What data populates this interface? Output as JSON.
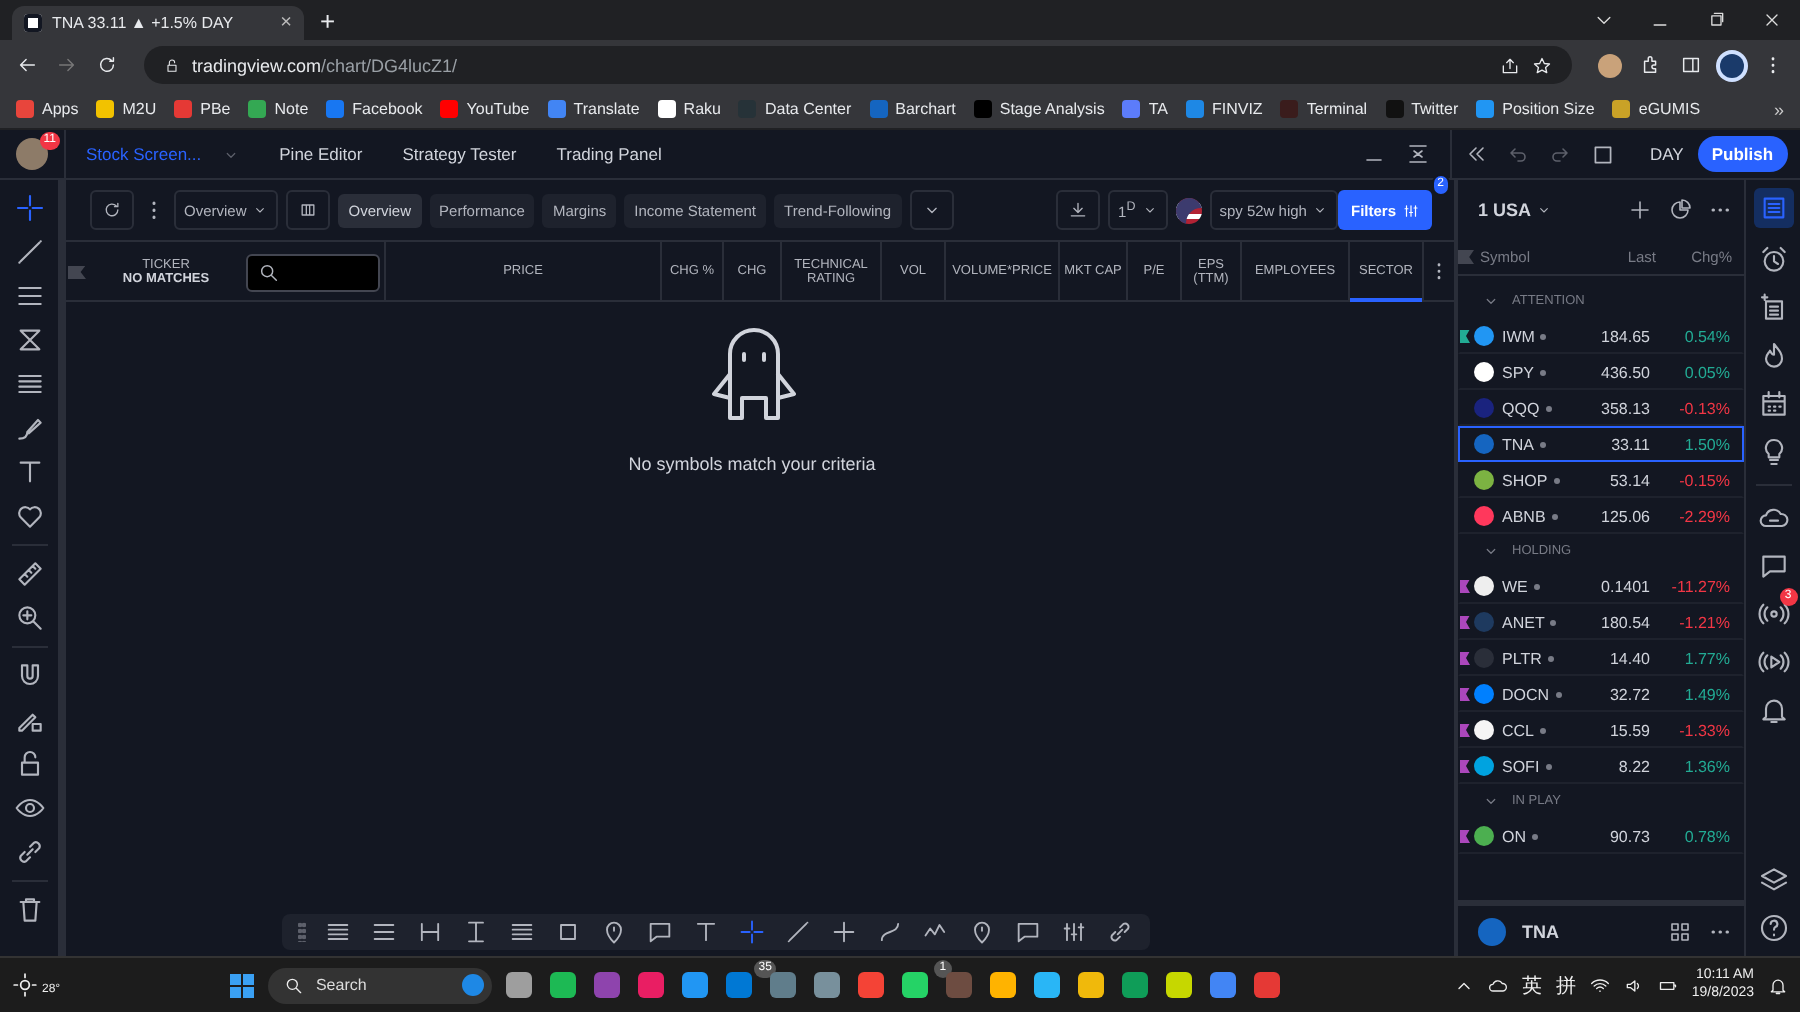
{
  "browser": {
    "tab": {
      "title": "TNA 33.11 ▲ +1.5% DAY",
      "close": "×"
    },
    "new_tab": "+",
    "url": {
      "host": "tradingview.com",
      "path": "/chart/DG4lucZ1/"
    },
    "bookmarks": [
      {
        "label": "Apps",
        "color": "#e8453c"
      },
      {
        "label": "M2U",
        "color": "#f2c200"
      },
      {
        "label": "PBe",
        "color": "#e53935"
      },
      {
        "label": "Note",
        "color": "#34a853"
      },
      {
        "label": "Facebook",
        "color": "#1877f2"
      },
      {
        "label": "YouTube",
        "color": "#ff0000"
      },
      {
        "label": "Translate",
        "color": "#4285f4"
      },
      {
        "label": "Raku",
        "color": "#ffffff"
      },
      {
        "label": "Data Center",
        "color": "#263238"
      },
      {
        "label": "Barchart",
        "color": "#1565c0"
      },
      {
        "label": "Stage Analysis",
        "color": "#000000"
      },
      {
        "label": "TA",
        "color": "#5c7cfa"
      },
      {
        "label": "FINVIZ",
        "color": "#1e88e5"
      },
      {
        "label": "Terminal",
        "color": "#3a1c1c"
      },
      {
        "label": "Twitter",
        "color": "#111111"
      },
      {
        "label": "Position Size",
        "color": "#2196f3"
      },
      {
        "label": "eGUMIS",
        "color": "#c9a227"
      }
    ],
    "bookmarks_more": "»"
  },
  "header": {
    "avatar_badge": "11",
    "tabs": [
      {
        "label": "Stock Screen...",
        "selected": true
      },
      {
        "label": "Pine Editor",
        "selected": false
      },
      {
        "label": "Strategy Tester",
        "selected": false
      },
      {
        "label": "Trading Panel",
        "selected": false
      }
    ],
    "timeframe": "DAY",
    "publish": "Publish"
  },
  "left_tools": [
    {
      "selected": true
    },
    {
      "selected": false
    },
    {
      "selected": false
    },
    {
      "selected": false
    },
    {
      "selected": false
    },
    {
      "selected": false
    },
    {
      "selected": false
    },
    {
      "selected": false
    },
    {
      "selected": false
    },
    {
      "selected": false
    },
    {
      "selected": false
    },
    {
      "selected": false
    },
    {
      "selected": false
    },
    {
      "selected": false
    },
    {
      "selected": false
    },
    {
      "selected": false
    }
  ],
  "screener": {
    "layout": "Overview",
    "views": [
      {
        "label": "Overview",
        "selected": true
      },
      {
        "label": "Performance",
        "selected": false
      },
      {
        "label": "Margins",
        "selected": false
      },
      {
        "label": "Income Statement",
        "selected": false
      },
      {
        "label": "Trend-Following",
        "selected": false
      }
    ],
    "interval": "1$^{D}$",
    "watchlist": "spy 52w high",
    "filters": "Filters",
    "filters_badge": "2",
    "columns": [
      {
        "label": "TICKER",
        "note": "NO MATCHES",
        "selected": false
      },
      {
        "label": "PRICE",
        "selected": false
      },
      {
        "label": "CHG %",
        "selected": false
      },
      {
        "label": "CHG",
        "selected": false
      },
      {
        "label": "TECHNICAL RATING",
        "selected": false
      },
      {
        "label": "VOL",
        "selected": false
      },
      {
        "label": "VOLUME*PRICE",
        "selected": false
      },
      {
        "label": "MKT CAP",
        "selected": false
      },
      {
        "label": "P/E",
        "selected": false
      },
      {
        "label": "EPS (TTM)",
        "selected": false
      },
      {
        "label": "EMPLOYEES",
        "selected": false
      },
      {
        "label": "SECTOR",
        "selected": true
      }
    ],
    "empty_message": "No symbols match your criteria"
  },
  "drawing_tools": [
    {
      "selected": false
    },
    {
      "selected": false
    },
    {
      "selected": false
    },
    {
      "selected": false
    },
    {
      "selected": false
    },
    {
      "selected": false
    },
    {
      "selected": false
    },
    {
      "selected": false
    },
    {
      "selected": false
    },
    {
      "selected": true
    },
    {
      "selected": false
    },
    {
      "selected": false
    },
    {
      "selected": false
    },
    {
      "selected": false
    },
    {
      "selected": false
    },
    {
      "selected": false
    },
    {
      "selected": false
    },
    {
      "selected": false
    }
  ],
  "watchlist": {
    "name": "1 USA",
    "columns": [
      "Symbol",
      "Last",
      "Chg%"
    ],
    "sections": [
      {
        "title": "ATTENTION",
        "expanded": true,
        "rows": [
          {
            "symbol": "IWM",
            "last": "184.65",
            "change": "0.54%",
            "selected": false,
            "flag": {
              "color": "#22ab94"
            },
            "logo": {
              "color": "#2196f3"
            }
          },
          {
            "symbol": "SPY",
            "last": "436.50",
            "change": "0.05%",
            "selected": false,
            "logo": {
              "color": "#ffffff"
            }
          },
          {
            "symbol": "QQQ",
            "last": "358.13",
            "change": "-0.13%",
            "selected": false,
            "logo": {
              "color": "#1a237e"
            }
          },
          {
            "symbol": "TNA",
            "last": "33.11",
            "change": "1.50%",
            "selected": true,
            "logo": {
              "color": "#1565c0"
            }
          },
          {
            "symbol": "SHOP",
            "last": "53.14",
            "change": "-0.15%",
            "selected": false,
            "logo": {
              "color": "#7cb342"
            }
          },
          {
            "symbol": "ABNB",
            "last": "125.06",
            "change": "-2.29%",
            "selected": false,
            "logo": {
              "color": "#ff385c"
            }
          }
        ]
      },
      {
        "title": "HOLDING",
        "expanded": true,
        "rows": [
          {
            "symbol": "WE",
            "last": "0.1401",
            "change": "-11.27%",
            "selected": false,
            "flag": {
              "color": "#ab47bc"
            },
            "logo": {
              "color": "#eeeeee"
            }
          },
          {
            "symbol": "ANET",
            "last": "180.54",
            "change": "-1.21%",
            "selected": false,
            "flag": {
              "color": "#ab47bc"
            },
            "logo": {
              "color": "#1e3a5f"
            }
          },
          {
            "symbol": "PLTR",
            "last": "14.40",
            "change": "1.77%",
            "selected": false,
            "flag": {
              "color": "#ab47bc"
            },
            "logo": {
              "color": "#2a2e39"
            }
          },
          {
            "symbol": "DOCN",
            "last": "32.72",
            "change": "1.49%",
            "selected": false,
            "flag": {
              "color": "#ab47bc"
            },
            "logo": {
              "color": "#0080ff"
            }
          },
          {
            "symbol": "CCL",
            "last": "15.59",
            "change": "-1.33%",
            "selected": false,
            "flag": {
              "color": "#ab47bc"
            },
            "logo": {
              "color": "#f5f5f5"
            }
          },
          {
            "symbol": "SOFI",
            "last": "8.22",
            "change": "1.36%",
            "selected": false,
            "flag": {
              "color": "#ab47bc"
            },
            "logo": {
              "color": "#00a3e0"
            }
          }
        ]
      },
      {
        "title": "IN PLAY",
        "expanded": true,
        "rows": [
          {
            "symbol": "ON",
            "last": "90.73",
            "change": "0.78%",
            "selected": false,
            "flag": {
              "color": "#ab47bc"
            },
            "logo": {
              "color": "#4caf50"
            }
          }
        ]
      }
    ],
    "details_symbol": "TNA"
  },
  "right_bar": {
    "badge": "3"
  },
  "taskbar": {
    "weather": "28°",
    "search": "Search",
    "apps": [
      {
        "color": "#9e9e9e"
      },
      {
        "color": "#1db954"
      },
      {
        "color": "#8e44ad"
      },
      {
        "color": "#e91e63"
      },
      {
        "color": "#2196f3"
      },
      {
        "color": "#0078d4",
        "badge": "35"
      },
      {
        "color": "#607d8b"
      },
      {
        "color": "#78909c"
      },
      {
        "color": "#f44336"
      },
      {
        "color": "#25d366",
        "badge": "1"
      },
      {
        "color": "#6d4c41"
      },
      {
        "color": "#ffb300"
      },
      {
        "color": "#29b6f6"
      },
      {
        "color": "#f0b90b"
      },
      {
        "color": "#0f9d58"
      },
      {
        "color": "#c6d700"
      },
      {
        "color": "#4285f4"
      },
      {
        "color": "#e53935"
      }
    ],
    "ime": [
      "英",
      "拼"
    ],
    "time": "10:11 AM",
    "date": "19/8/2023"
  }
}
